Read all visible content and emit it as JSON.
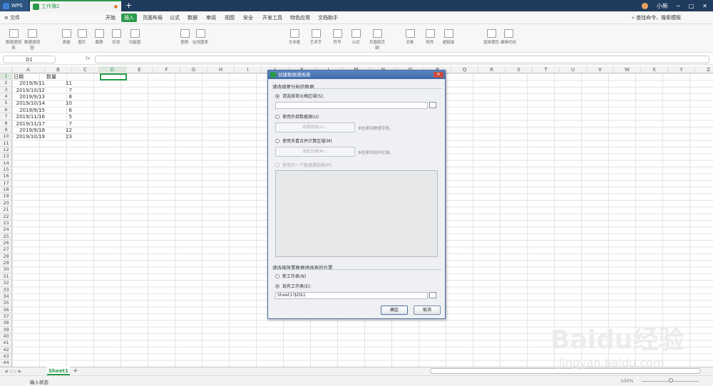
{
  "titlebar": {
    "app_tab": "WPS",
    "doc_tab": "工作簿2",
    "user": "小新"
  },
  "menubar": {
    "file": "文件",
    "items": [
      "开始",
      "插入",
      "页面布局",
      "公式",
      "数据",
      "审阅",
      "视图",
      "安全",
      "开发工具",
      "特色应用",
      "文档助手"
    ],
    "search": "查找命令、搜索模板"
  },
  "toolbar": {
    "buttons": [
      "数据透视表",
      "数据透视图",
      "表格",
      "图片",
      "截屏",
      "形状",
      "功能图",
      "图表",
      "在线图表",
      "文本框",
      "艺术字",
      "符号",
      "公式",
      "页眉和页脚",
      "对象",
      "附件",
      "超链接",
      "窗体属性",
      "编辑代码"
    ]
  },
  "formulabar": {
    "cell_ref": "D1",
    "fx": "fx",
    "content": ""
  },
  "columns": [
    "A",
    "B",
    "C",
    "D",
    "E",
    "F",
    "G",
    "H",
    "I",
    "J",
    "K",
    "L",
    "M",
    "N",
    "O",
    "P",
    "Q",
    "R",
    "S",
    "T",
    "U",
    "V",
    "W",
    "X",
    "Y",
    "Z"
  ],
  "rows": [
    "1",
    "2",
    "3",
    "4",
    "5",
    "6",
    "7",
    "8",
    "9",
    "10",
    "11",
    "12",
    "13",
    "14",
    "15",
    "16",
    "17",
    "18",
    "19",
    "20",
    "21",
    "22",
    "23",
    "24",
    "25",
    "26",
    "27",
    "28",
    "29",
    "30",
    "31",
    "32",
    "33",
    "34",
    "35",
    "36",
    "37",
    "38",
    "39",
    "40",
    "41",
    "42",
    "43",
    "44"
  ],
  "table": {
    "headers": [
      "日期",
      "数量"
    ],
    "dates": [
      "2019/9/11",
      "2019/10/12",
      "2019/9/13",
      "2019/10/14",
      "2019/9/15",
      "2019/11/16",
      "2019/11/17",
      "2019/9/18",
      "2019/10/19"
    ],
    "quantities": [
      "11",
      "7",
      "8",
      "10",
      "6",
      "5",
      "7",
      "12",
      "23"
    ]
  },
  "sheetbar": {
    "sheet_name": "Sheet1",
    "add": "+"
  },
  "statusbar": {
    "mode": "输入状态",
    "zoom": "100%"
  },
  "dialog": {
    "title": "创建数据透视表",
    "section1": "请选择要分析的数据",
    "opt_range": "请选择单元格区域(S):",
    "range_value": "",
    "opt_external": "使用外部数据源(U)",
    "btn_connection": "选择连接(C)...",
    "hint_connection": "未检索到数据字段。",
    "opt_multi": "使用多重合并计算区域(M)",
    "btn_region": "选定区域(R)...",
    "hint_region": "未检索到选中区域。",
    "opt_other": "使用另一个数据透视表(P):",
    "section2": "请选择放置数据透视表的位置",
    "opt_new": "新工作表(N)",
    "opt_existing": "现有工作表(E):",
    "existing_value": "Sheet1!$D$1",
    "ok": "确定",
    "cancel": "取消"
  },
  "watermark": {
    "brand": "Baidu经验",
    "url": "jingyan.baidu.com"
  },
  "colors": {
    "accent": "#2a9a4a",
    "titlebar": "#1f3b5e",
    "dialog_title": "#4a74b0"
  }
}
